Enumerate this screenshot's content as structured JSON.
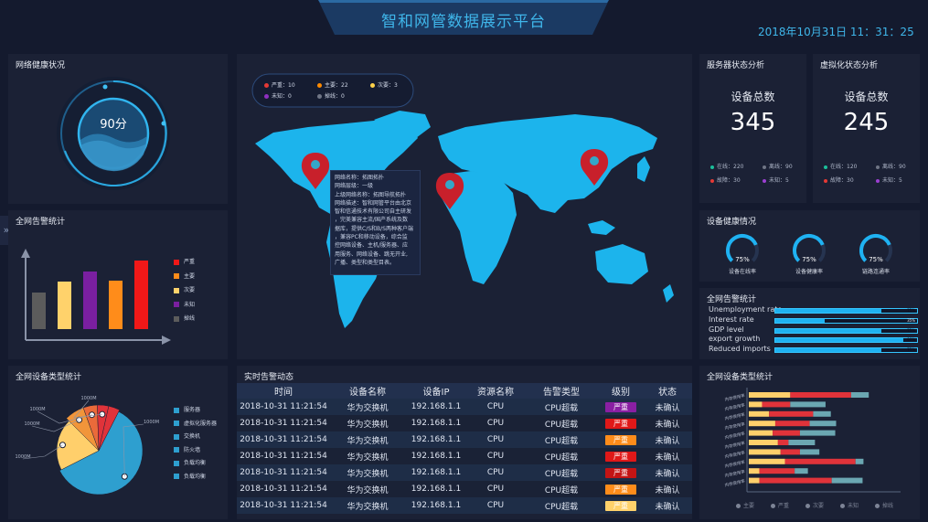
{
  "header": {
    "title": "智和网管数据展示平台",
    "datetime": "2018年10月31日  11：31：25"
  },
  "panels": {
    "network_health": "网络健康状况",
    "alarm_stats": "全网告警统计",
    "device_types": "全网设备类型统计",
    "server_status": "服务器状态分析",
    "virtual_status": "虚拟化状态分析",
    "device_health": "设备健康情况",
    "alarm_stats_right": "全网告警统计",
    "device_types_right": "全网设备类型统计",
    "realtime_alarms": "实时告警动态"
  },
  "health_score": "90分",
  "map": {
    "legend": [
      {
        "label": "严重：10",
        "color": "#e53935"
      },
      {
        "label": "主要：22",
        "color": "#ff8a00"
      },
      {
        "label": "次要：3",
        "color": "#ffd24a"
      },
      {
        "label": "未知：0",
        "color": "#8e2fbf"
      },
      {
        "label": "掉线：0",
        "color": "#6f7585"
      }
    ],
    "tooltip_lines": [
      "网络名称：拓图拓扑",
      "网络层级：一级",
      "上级网络名称：拓图导航拓扑",
      "网络描述：智和网管平台由北京",
      "智和信通技术有限公司自主研发",
      "，完美兼容主流/国产系统及数",
      "据库，提供C/S和B/S两种客户端",
      "，兼容PC和移动设备，综合监",
      "控网络设备、主机/服务器、应",
      "用服务、网络设备、跳无开业,",
      "广播、类型和类型目表。"
    ]
  },
  "server_status": {
    "caption": "设备总数",
    "total": "345",
    "rows": [
      [
        {
          "label": "在线：220",
          "color": "#1bbf9a"
        },
        {
          "label": "离线：90",
          "color": "#6f7585"
        }
      ],
      [
        {
          "label": "故障：30",
          "color": "#e53935"
        },
        {
          "label": "未知：5",
          "color": "#9c3fd1"
        }
      ]
    ]
  },
  "virtual_status": {
    "caption": "设备总数",
    "total": "245",
    "rows": [
      [
        {
          "label": "在线：120",
          "color": "#1bbf9a"
        },
        {
          "label": "离线：90",
          "color": "#6f7585"
        }
      ],
      [
        {
          "label": "故障：30",
          "color": "#e53935"
        },
        {
          "label": "未知：5",
          "color": "#9c3fd1"
        }
      ]
    ]
  },
  "device_health": {
    "gauges": [
      {
        "value": "75%",
        "label": "设备在线率",
        "level": 0.75
      },
      {
        "value": "75%",
        "label": "设备健康率",
        "level": 0.75
      },
      {
        "value": "75%",
        "label": "链路连通率",
        "level": 0.75
      }
    ]
  },
  "alarm_bar_chart": {
    "legend": [
      {
        "label": "严重",
        "color": "#f01818"
      },
      {
        "label": "主要",
        "color": "#ff8c1a"
      },
      {
        "label": "次要",
        "color": "#ffd26b"
      },
      {
        "label": "未知",
        "color": "#7a1fa0"
      },
      {
        "label": "掉线",
        "color": "#5c5c5c"
      }
    ]
  },
  "indicators": [
    {
      "label": "Unemployment rate",
      "value": "75%",
      "level": 0.75
    },
    {
      "label": "Interest rate",
      "value": "35%",
      "level": 0.35
    },
    {
      "label": "GDP level",
      "value": "75%",
      "level": 0.75
    },
    {
      "label": "export growth",
      "value": "90%",
      "level": 0.9
    },
    {
      "label": "Reduced imports",
      "value": "75%",
      "level": 0.75
    }
  ],
  "pie_legend": [
    {
      "label": "服务器",
      "color": "#2e9fcf"
    },
    {
      "label": "虚拟化服务器",
      "color": "#2e9fcf"
    },
    {
      "label": "交换机",
      "color": "#2e9fcf"
    },
    {
      "label": "防火墙",
      "color": "#2e9fcf"
    },
    {
      "label": "负载均衡",
      "color": "#2e9fcf"
    },
    {
      "label": "负载均衡",
      "color": "#2e9fcf"
    }
  ],
  "stacked_legend": [
    {
      "label": "主要",
      "color": "#7d8496"
    },
    {
      "label": "严重",
      "color": "#7d8496"
    },
    {
      "label": "次要",
      "color": "#7d8496"
    },
    {
      "label": "未知",
      "color": "#7d8496"
    },
    {
      "label": "掉线",
      "color": "#7d8496"
    }
  ],
  "alarm_table": {
    "headers": [
      "时间",
      "设备名称",
      "设备IP",
      "资源名称",
      "告警类型",
      "级别",
      "状态"
    ],
    "rows": [
      {
        "time": "2018-10-31 11:21:54",
        "device": "华为交换机",
        "ip": "192.168.1.1",
        "resource": "CPU",
        "type": "CPU超载",
        "level": "严重",
        "level_color": "#8a1fa3",
        "status": "未确认"
      },
      {
        "time": "2018-10-31 11:21:54",
        "device": "华为交换机",
        "ip": "192.168.1.1",
        "resource": "CPU",
        "type": "CPU超载",
        "level": "严重",
        "level_color": "#e01818",
        "status": "未确认"
      },
      {
        "time": "2018-10-31 11:21:54",
        "device": "华为交换机",
        "ip": "192.168.1.1",
        "resource": "CPU",
        "type": "CPU超载",
        "level": "严重",
        "level_color": "#ff8c1a",
        "status": "未确认"
      },
      {
        "time": "2018-10-31 11:21:54",
        "device": "华为交换机",
        "ip": "192.168.1.1",
        "resource": "CPU",
        "type": "CPU超载",
        "level": "严重",
        "level_color": "#e01818",
        "status": "未确认"
      },
      {
        "time": "2018-10-31 11:21:54",
        "device": "华为交换机",
        "ip": "192.168.1.1",
        "resource": "CPU",
        "type": "CPU超载",
        "level": "严重",
        "level_color": "#c41414",
        "status": "未确认"
      },
      {
        "time": "2018-10-31 11:21:54",
        "device": "华为交换机",
        "ip": "192.168.1.1",
        "resource": "CPU",
        "type": "CPU超载",
        "level": "严重",
        "level_color": "#ff8c1a",
        "status": "未确认"
      },
      {
        "time": "2018-10-31 11:21:54",
        "device": "华为交换机",
        "ip": "192.168.1.1",
        "resource": "CPU",
        "type": "CPU超载",
        "level": "严重",
        "level_color": "#ffd26b",
        "status": "未确认"
      }
    ]
  },
  "chart_data": [
    {
      "type": "bar",
      "categories": [
        "掉线",
        "次要",
        "未知",
        "主要",
        "严重"
      ],
      "values": [
        40,
        52,
        63,
        53,
        75
      ],
      "colors": [
        "#5c5c5c",
        "#ffd26b",
        "#7a1fa0",
        "#ff8c1a",
        "#f01818"
      ],
      "ylim": [
        0,
        100
      ],
      "grid": false,
      "legend": "right"
    },
    {
      "type": "pie",
      "labels": [
        "服务器",
        "虚拟化服务器",
        "交换机",
        "防火墙",
        "负载均衡",
        "负载均衡"
      ],
      "values": [
        60,
        20,
        7,
        5,
        4,
        4
      ],
      "colors": [
        "#2e9fcf",
        "#ffcf6b",
        "#f1953a",
        "#ea6a3a",
        "#e0333a",
        "#e0333a"
      ],
      "slice_labels": [
        "1000M",
        "1000M",
        "1000M",
        "1000M",
        "1000M"
      ],
      "legend": "right"
    },
    {
      "type": "bar",
      "orientation": "horizontal",
      "stacked": true,
      "categories": [
        "1",
        "2",
        "3",
        "4",
        "5",
        "6",
        "7",
        "8",
        "9",
        "10"
      ],
      "y_tick_label": "内存使用率",
      "series": [
        {
          "values": [
            47,
            15,
            23,
            30,
            27,
            33,
            36,
            41,
            12,
            12
          ],
          "color": "#ffcf6b"
        },
        {
          "values": [
            69,
            32,
            50,
            39,
            31,
            12,
            22,
            80,
            40,
            82
          ],
          "color": "#e0333a"
        },
        {
          "values": [
            20,
            40,
            20,
            30,
            40,
            30,
            22,
            9,
            15,
            35
          ],
          "color": "#6ba7b2"
        }
      ],
      "xlim": [
        0,
        170
      ],
      "legend": "bottom"
    }
  ]
}
